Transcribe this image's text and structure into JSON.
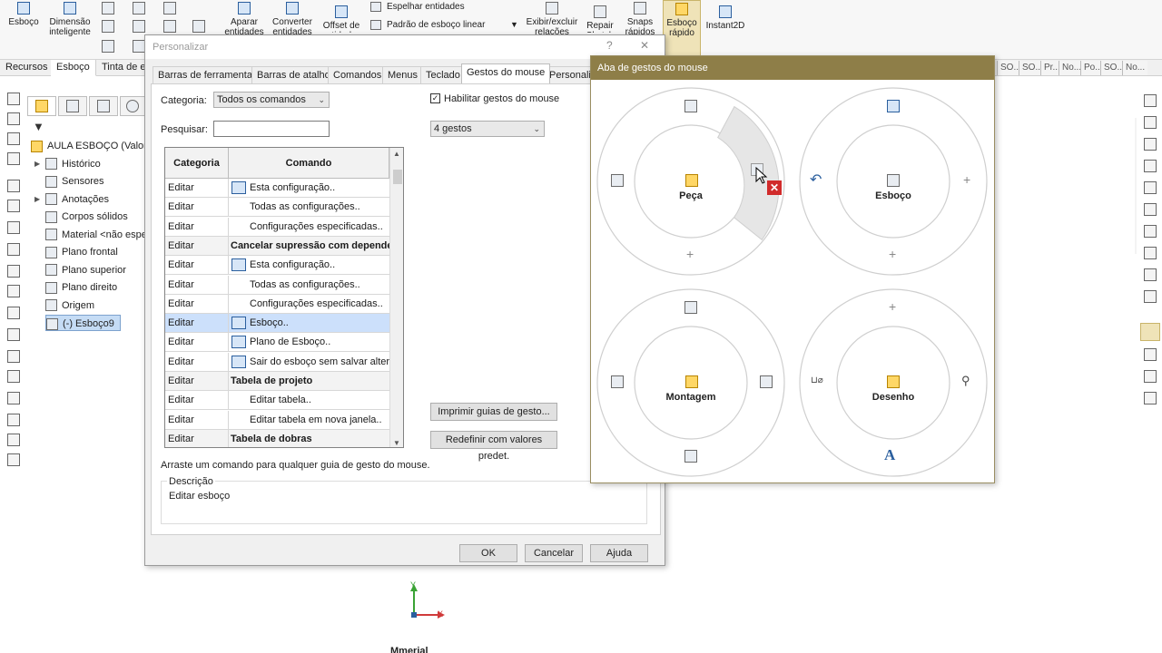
{
  "ribbon": {
    "buttons": [
      {
        "label": "Esboço",
        "icon": "sketch-icon"
      },
      {
        "label": "Dimensão inteligente",
        "icon": "smart-dimension-icon"
      },
      {
        "label": "Aparar entidades",
        "icon": "trim-icon"
      },
      {
        "label": "Converter entidades",
        "icon": "convert-icon"
      },
      {
        "label": "Offset de entidades",
        "icon": "offset-icon"
      },
      {
        "label": "Exibir/excluir relações",
        "icon": "relations-icon"
      },
      {
        "label": "Repair Sketch",
        "icon": "repair-icon"
      },
      {
        "label": "Snaps rápidos",
        "icon": "snap-icon"
      },
      {
        "label": "Esboço rápido",
        "icon": "rapid-sketch-icon"
      },
      {
        "label": "Instant2D",
        "icon": "instant2d-icon"
      }
    ],
    "mirror_label": "Espelhar entidades",
    "linear_pattern_label": "Padrão de esboço linear"
  },
  "command_tabs": [
    "Recursos",
    "Esboço",
    "Tinta de e"
  ],
  "right_tabs": [
    "SO...",
    "SO...",
    "Pr...",
    "No...",
    "Po...",
    "SO...",
    "No..."
  ],
  "tree": {
    "items": [
      {
        "label": "AULA ESBOÇO  (Valor p",
        "icon": "part-icon",
        "expand": ""
      },
      {
        "label": "Histórico",
        "icon": "history-icon",
        "expand": "▶"
      },
      {
        "label": "Sensores",
        "icon": "sensor-icon",
        "expand": ""
      },
      {
        "label": "Anotações",
        "icon": "annotation-icon",
        "expand": "▶"
      },
      {
        "label": "Corpos sólidos",
        "icon": "solid-bodies-icon",
        "expand": ""
      },
      {
        "label": "Material <não espe",
        "icon": "material-icon",
        "expand": ""
      },
      {
        "label": "Plano frontal",
        "icon": "plane-icon",
        "expand": ""
      },
      {
        "label": "Plano superior",
        "icon": "plane-icon",
        "expand": ""
      },
      {
        "label": "Plano direito",
        "icon": "plane-icon",
        "expand": ""
      },
      {
        "label": "Origem",
        "icon": "origin-icon",
        "expand": ""
      },
      {
        "label": "(-) Esboço9",
        "icon": "sketch-icon",
        "expand": ""
      }
    ]
  },
  "dialog": {
    "title": "Personalizar",
    "help_btn": "?",
    "close_btn": "✕",
    "tabs": [
      "Barras de ferramentas",
      "Barras de atalho",
      "Comandos",
      "Menus",
      "Teclado",
      "Gestos do mouse",
      "Personaliz"
    ],
    "active_tab": "Gestos do mouse",
    "category_label": "Categoria:",
    "category_value": "Todos os comandos",
    "search_label": "Pesquisar:",
    "search_value": "",
    "enable_label": "Habilitar gestos do mouse",
    "enable_checked": "✓",
    "gestures_value": "4 gestos",
    "grid": {
      "headers": [
        "Categoria",
        "Comando"
      ],
      "rows": [
        {
          "cat": "Editar",
          "cmd": "Esta configuração..",
          "type": "item",
          "icon": "config-icon"
        },
        {
          "cat": "Editar",
          "cmd": "Todas as configurações..",
          "type": "item",
          "icon": ""
        },
        {
          "cat": "Editar",
          "cmd": "Configurações especificadas..",
          "type": "item",
          "icon": ""
        },
        {
          "cat": "Editar",
          "cmd": "Cancelar supressão com dependentes",
          "type": "cat",
          "icon": ""
        },
        {
          "cat": "Editar",
          "cmd": "Esta configuração..",
          "type": "item",
          "icon": "config-icon"
        },
        {
          "cat": "Editar",
          "cmd": "Todas as configurações..",
          "type": "item",
          "icon": ""
        },
        {
          "cat": "Editar",
          "cmd": "Configurações especificadas..",
          "type": "item",
          "icon": ""
        },
        {
          "cat": "Editar",
          "cmd": "Esboço..",
          "type": "sel",
          "icon": "edit-sketch-icon"
        },
        {
          "cat": "Editar",
          "cmd": "Plano de Esboço..",
          "type": "item",
          "icon": "sketch-plane-icon"
        },
        {
          "cat": "Editar",
          "cmd": "Sair do esboço sem salvar alterac",
          "type": "item",
          "icon": "exit-sketch-icon"
        },
        {
          "cat": "Editar",
          "cmd": "Tabela de projeto",
          "type": "cat",
          "icon": ""
        },
        {
          "cat": "Editar",
          "cmd": "Editar tabela..",
          "type": "item",
          "icon": ""
        },
        {
          "cat": "Editar",
          "cmd": "Editar tabela em nova janela..",
          "type": "item",
          "icon": ""
        },
        {
          "cat": "Editar",
          "cmd": "Tabela de dobras",
          "type": "cat",
          "icon": ""
        }
      ]
    },
    "print_btn": "Imprimir guias de gesto...",
    "reset_btn": "Redefinir com valores predet.",
    "drag_hint": "Arraste um comando para qualquer guia de gesto do mouse.",
    "desc_label": "Descrição",
    "desc_text": "Editar esboço",
    "ok": "OK",
    "cancel": "Cancelar",
    "help": "Ajuda"
  },
  "gesture_panel": {
    "title": "Aba de gestos do mouse",
    "rings": [
      {
        "label": "Peça",
        "center_icon": "part-icon"
      },
      {
        "label": "Esboço",
        "center_icon": "sketch-icon"
      },
      {
        "label": "Montagem",
        "center_icon": "assembly-icon"
      },
      {
        "label": "Desenho",
        "center_icon": "drawing-icon"
      }
    ],
    "plus": "+"
  },
  "graphics": {
    "triad_y": "Y",
    "triad_x": "X",
    "bottom_text": "Mmerial"
  },
  "colors": {
    "gesture_title_bg": "#8e7e48",
    "selection": "#cce0fb",
    "accent": "#2b5f9e"
  }
}
